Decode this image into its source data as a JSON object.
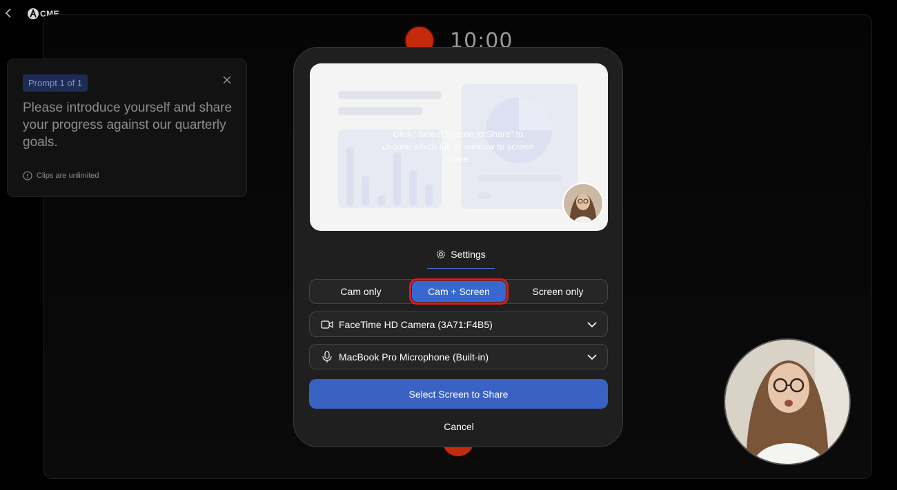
{
  "header": {
    "logo_text": "CME"
  },
  "recording": {
    "timer": "10:00"
  },
  "prompt": {
    "badge": "Prompt 1 of 1",
    "text": "Please introduce yourself and share your progress against our quarterly goals.",
    "footer": "Clips are unlimited"
  },
  "modal": {
    "preview_hint": "Click \"Select Screen to Share\" to choose which tab or window to screen share.",
    "settings_tab": "Settings",
    "modes": [
      "Cam only",
      "Cam + Screen",
      "Screen only"
    ],
    "active_mode": "Cam + Screen",
    "camera_select": "FaceTime HD Camera (3A71:F4B5)",
    "mic_select": "MacBook Pro Microphone (Built-in)",
    "primary_button": "Select Screen to Share",
    "cancel_button": "Cancel"
  },
  "colors": {
    "accent": "#3a62c3",
    "record": "#c42a0c",
    "highlight": "#e01b1b"
  }
}
